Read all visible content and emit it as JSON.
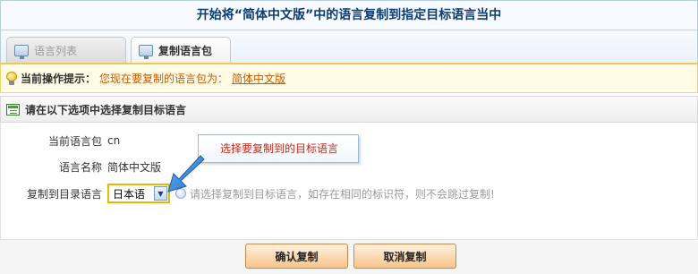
{
  "header": {
    "title": "开始将“简体中文版”中的语言复制到指定目标语言当中"
  },
  "tabs": [
    {
      "label": "语言列表",
      "active": false,
      "icon": "monitor-icon"
    },
    {
      "label": "复制语言包",
      "active": true,
      "icon": "monitor-icon"
    }
  ],
  "notice": {
    "label": "当前操作提示：",
    "text": "您现在要复制的语言包为：",
    "link": "简体中文版"
  },
  "section": {
    "title": "请在以下选项中选择复制目标语言"
  },
  "form": {
    "current_pack_label": "当前语言包",
    "current_pack_value": "cn",
    "lang_name_label": "语言名称",
    "lang_name_value": "简体中文版",
    "target_label": "复制到目录语言",
    "target_selected": "日本语",
    "target_hint": "请选择复制到目标语言，如存在相同的标识符，则不会跳过复制!"
  },
  "tooltip": {
    "text": "选择要复制到的目标语言"
  },
  "buttons": {
    "confirm": "确认复制",
    "cancel": "取消复制"
  },
  "colors": {
    "title_text": "#0b3c74",
    "notice_text": "#c85a00",
    "tooltip_text": "#c62a1a",
    "select_border": "#e6b800",
    "button_gradient_bottom": "#f6c489"
  }
}
